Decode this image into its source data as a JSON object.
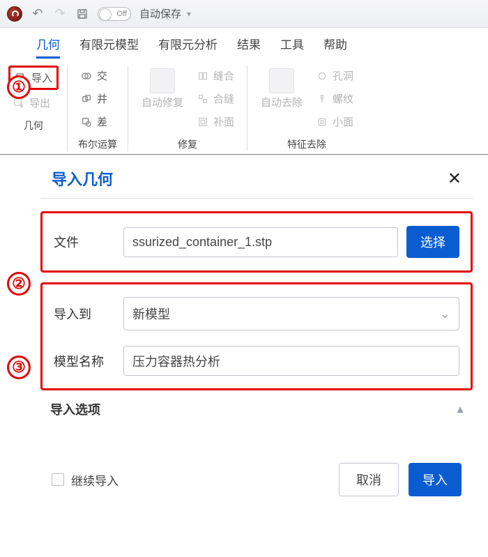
{
  "titlebar": {
    "toggle_text": "Off",
    "autosave_label": "自动保存"
  },
  "tabs": [
    "几何",
    "有限元模型",
    "有限元分析",
    "结果",
    "工具",
    "帮助"
  ],
  "active_tab_index": 0,
  "ribbon": {
    "geometry": {
      "label": "几何",
      "import": "导入",
      "export": "导出"
    },
    "boolean": {
      "label": "布尔运算",
      "intersect": "交",
      "union": "并",
      "subtract": "差"
    },
    "repair": {
      "label": "修复",
      "auto_repair": "自动修复",
      "sew": "缝合",
      "merge_seam": "合缝",
      "patch": "补面"
    },
    "feature_remove": {
      "label": "特征去除",
      "auto_remove": "自动去除",
      "hole": "孔洞",
      "thread": "螺纹",
      "small_face": "小面"
    }
  },
  "steps": {
    "s1": "①",
    "s2": "②",
    "s3": "③"
  },
  "dialog": {
    "title": "导入几何",
    "file_label": "文件",
    "file_value": "ssurized_container_1.stp",
    "select_btn": "选择",
    "import_to_label": "导入到",
    "import_to_value": "新模型",
    "model_name_label": "模型名称",
    "model_name_value": "压力容器热分析",
    "options_section": "导入选项",
    "continue_import": "继续导入",
    "cancel": "取消",
    "import": "导入"
  }
}
